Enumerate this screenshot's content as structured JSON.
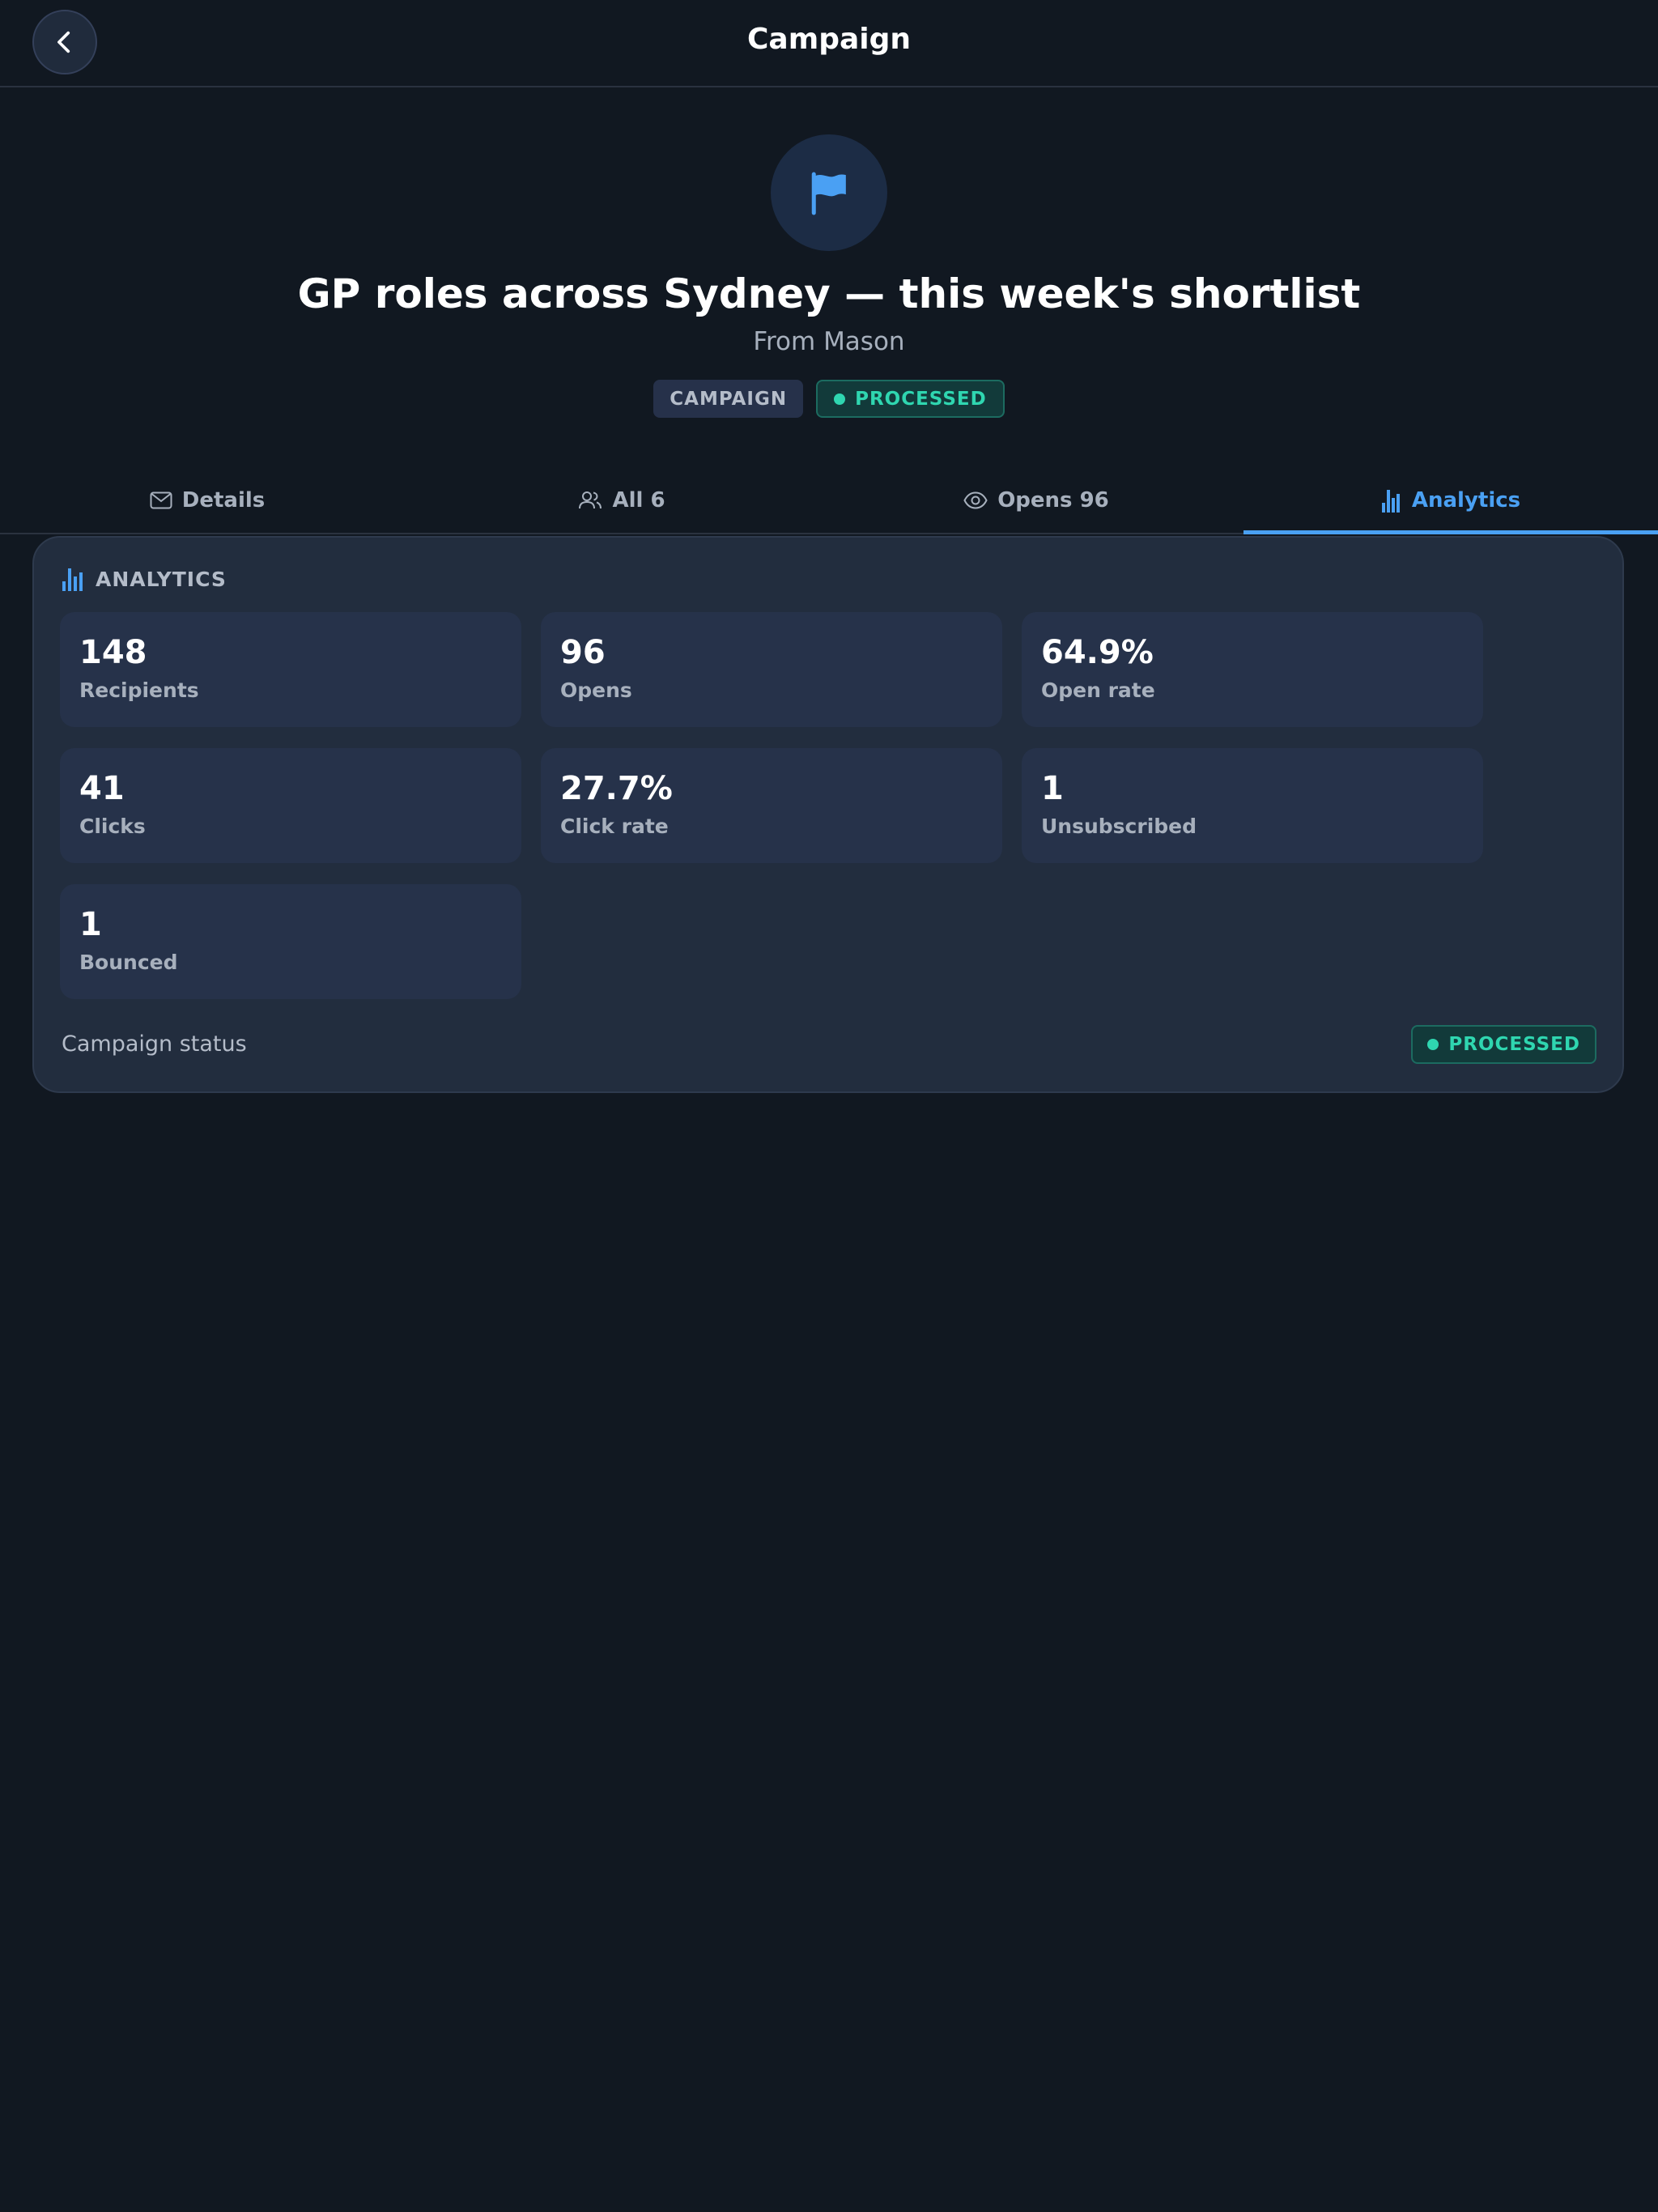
{
  "header": {
    "title": "Campaign",
    "back_icon": "chevron-left-icon"
  },
  "hero": {
    "icon": "flag-icon",
    "title": "GP roles across Sydney — this week's shortlist",
    "subtitle": "From Mason",
    "badges": {
      "type": "CAMPAIGN",
      "status": "PROCESSED"
    }
  },
  "tabs": [
    {
      "label": "Details",
      "icon": "mail-icon",
      "active": false
    },
    {
      "label": "All 6",
      "icon": "users-icon",
      "active": false
    },
    {
      "label": "Opens 96",
      "icon": "eye-icon",
      "active": false
    },
    {
      "label": "Analytics",
      "icon": "bar-chart-icon",
      "active": true
    }
  ],
  "analytics": {
    "heading": "ANALYTICS",
    "stats": [
      {
        "value": "148",
        "label": "Recipients"
      },
      {
        "value": "96",
        "label": "Opens"
      },
      {
        "value": "64.9%",
        "label": "Open rate"
      },
      {
        "value": "41",
        "label": "Clicks"
      },
      {
        "value": "27.7%",
        "label": "Click rate"
      },
      {
        "value": "1",
        "label": "Unsubscribed"
      },
      {
        "value": "1",
        "label": "Bounced"
      }
    ],
    "status_label": "Campaign status",
    "status_value": "PROCESSED"
  },
  "colors": {
    "background": "#111821",
    "card": "#222d3e",
    "accent": "#4aa0f3",
    "success": "#2fd6b0"
  }
}
